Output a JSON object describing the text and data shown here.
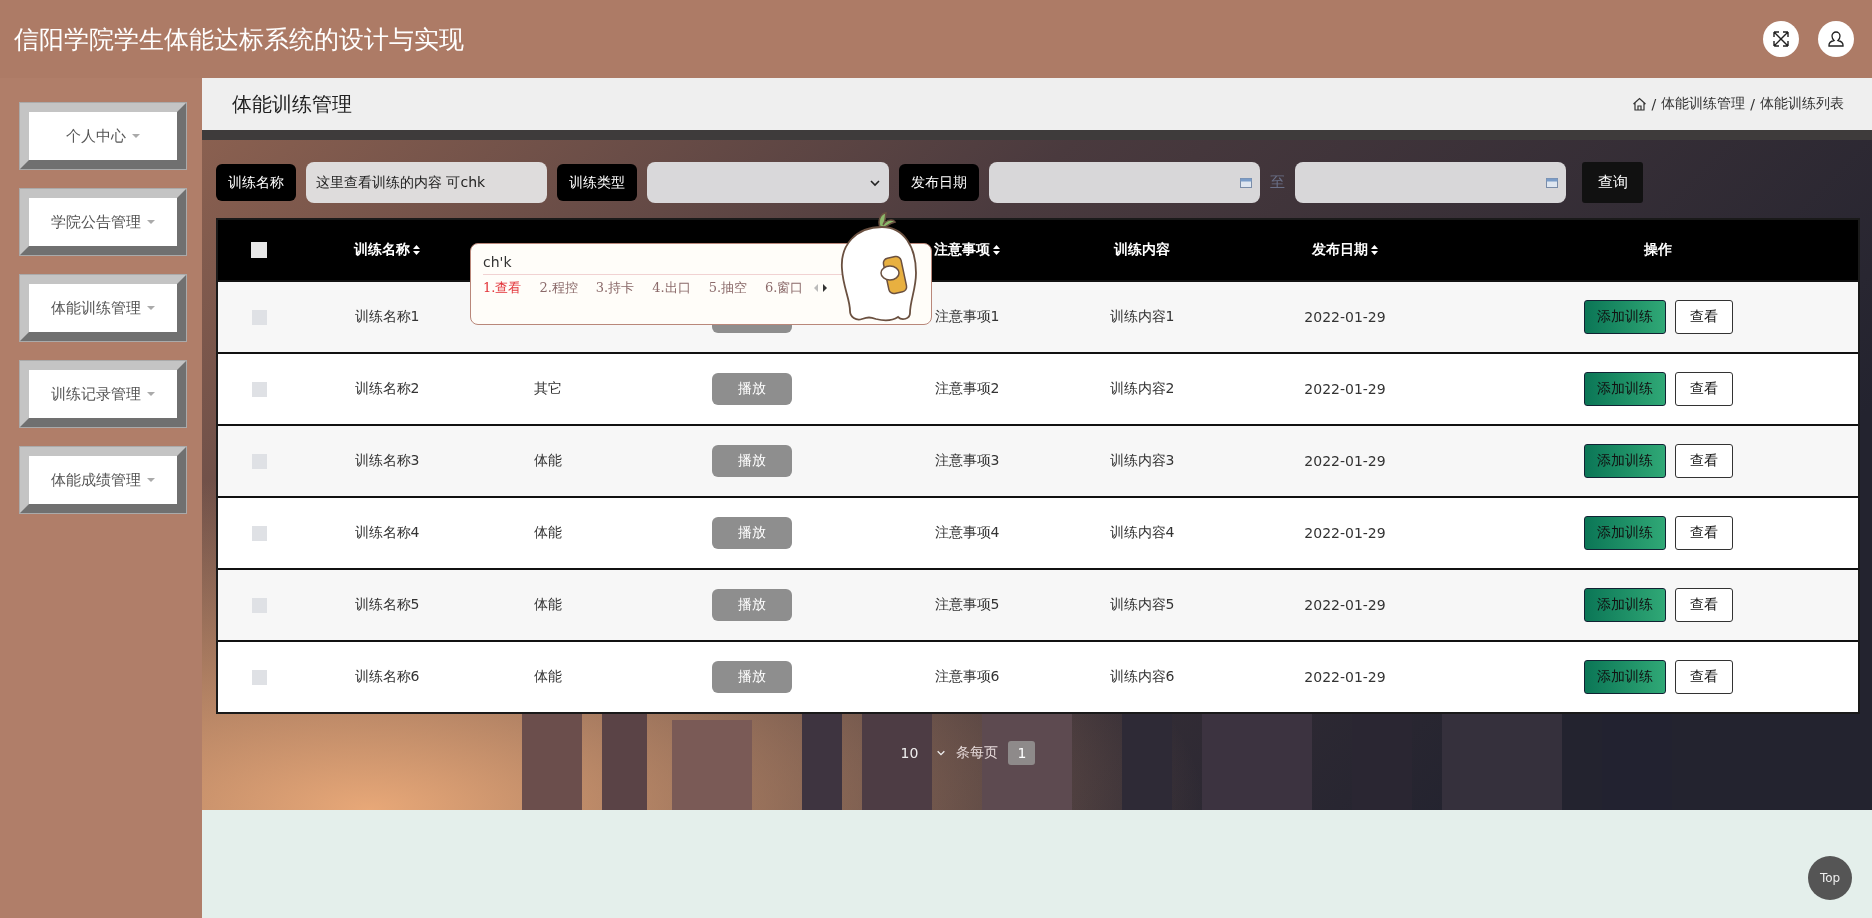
{
  "header": {
    "title": "信阳学院学生体能达标系统的设计与实现"
  },
  "sidebar": {
    "items": [
      {
        "label": "个人中心"
      },
      {
        "label": "学院公告管理"
      },
      {
        "label": "体能训练管理"
      },
      {
        "label": "训练记录管理"
      },
      {
        "label": "体能成绩管理"
      }
    ]
  },
  "page": {
    "title": "体能训练管理",
    "breadcrumb": {
      "separator": "/",
      "items": [
        "体能训练管理",
        "体能训练列表"
      ]
    }
  },
  "filters": {
    "name_label": "训练名称",
    "name_value": "这里查看训练的内容 可chk",
    "type_label": "训练类型",
    "date_label": "发布日期",
    "date_separator": "至",
    "search_button": "查询"
  },
  "table": {
    "header_checked": false,
    "columns": [
      {
        "label": "训练名称",
        "sortable": true
      },
      null,
      null,
      {
        "label": "注意事项",
        "sortable": true
      },
      {
        "label": "训练内容",
        "sortable": false
      },
      {
        "label": "发布日期",
        "sortable": true
      },
      {
        "label": "操作",
        "sortable": false
      }
    ],
    "rows": [
      {
        "checked": false,
        "name": "训练名称1",
        "notes": "注意事项1",
        "content": "训练内容1",
        "date": "2022-01-29",
        "actions": [
          "添加训练",
          "查看"
        ]
      },
      {
        "checked": false,
        "name": "训练名称2",
        "type": "其它",
        "video": "播放",
        "notes": "注意事项2",
        "content": "训练内容2",
        "date": "2022-01-29",
        "actions": [
          "添加训练",
          "查看"
        ]
      },
      {
        "checked": false,
        "name": "训练名称3",
        "type": "体能",
        "video": "播放",
        "notes": "注意事项3",
        "content": "训练内容3",
        "date": "2022-01-29",
        "actions": [
          "添加训练",
          "查看"
        ]
      },
      {
        "checked": false,
        "name": "训练名称4",
        "type": "体能",
        "video": "播放",
        "notes": "注意事项4",
        "content": "训练内容4",
        "date": "2022-01-29",
        "actions": [
          "添加训练",
          "查看"
        ]
      },
      {
        "checked": false,
        "name": "训练名称5",
        "type": "体能",
        "video": "播放",
        "notes": "注意事项5",
        "content": "训练内容5",
        "date": "2022-01-29",
        "actions": [
          "添加训练",
          "查看"
        ]
      },
      {
        "checked": false,
        "name": "训练名称6",
        "type": "体能",
        "video": "播放",
        "notes": "注意事项6",
        "content": "训练内容6",
        "date": "2022-01-29",
        "actions": [
          "添加训练",
          "查看"
        ]
      }
    ]
  },
  "pagination": {
    "page_size": "10",
    "page_size_suffix": "条每页",
    "pages": [
      {
        "label": "1",
        "selected": true
      }
    ]
  },
  "ime": {
    "composition": "ch'k",
    "candidates": [
      {
        "label": "1.查看",
        "selected": true
      },
      {
        "label": "2.程控",
        "selected": false
      },
      {
        "label": "3.持卡",
        "selected": false
      },
      {
        "label": "4.出口",
        "selected": false
      },
      {
        "label": "5.抽空",
        "selected": false
      },
      {
        "label": "6.窗口",
        "selected": false
      }
    ]
  },
  "back_to_top": "Top"
}
